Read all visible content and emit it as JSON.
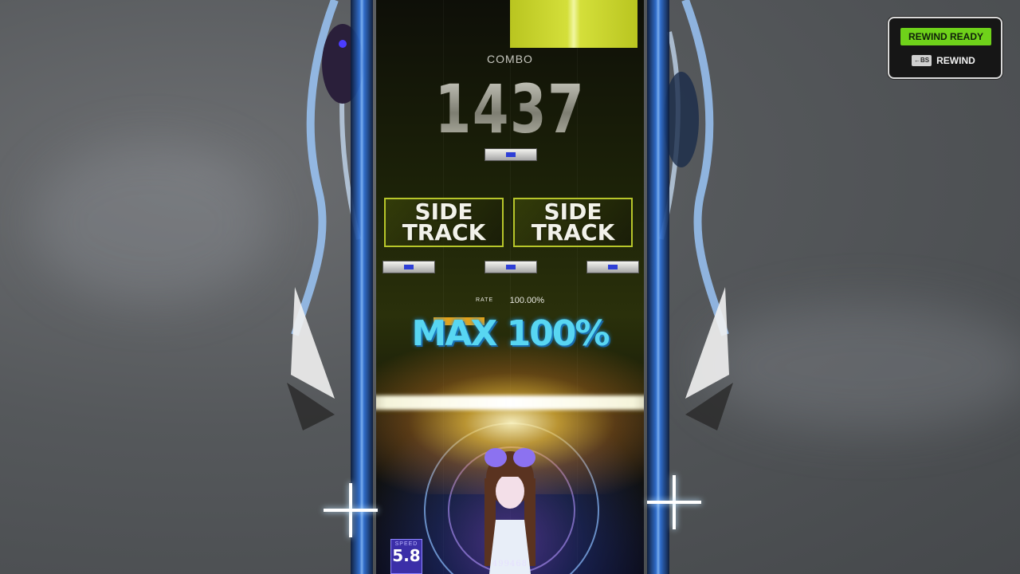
{
  "hud": {
    "combo_label": "COMBO",
    "combo_value": "1437",
    "side_track_left": [
      "SIDE",
      "TRACK"
    ],
    "side_track_right": [
      "SIDE",
      "TRACK"
    ],
    "rate_label": "RATE",
    "rate_value": "100.00%",
    "max_text": "MAX 100%",
    "speed_label": "SPEED",
    "speed_value": "5.8",
    "score": "499468"
  },
  "rewind": {
    "ready_label": "REWIND READY",
    "key_label": "←BS",
    "action_label": "REWIND"
  },
  "colors": {
    "note_yellow": "#d4df3a",
    "side_track_border": "#b7c62a",
    "max_text": "#58d6f2",
    "rewind_ready_bg": "#6fd21a",
    "speed_box": "#3b2fa8"
  }
}
